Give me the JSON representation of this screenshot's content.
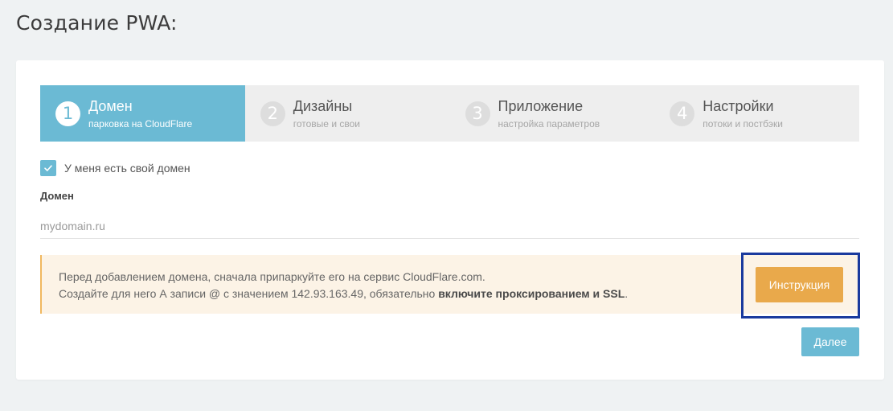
{
  "page": {
    "title": "Создание PWA:"
  },
  "steps": [
    {
      "num": "1",
      "title": "Домен",
      "sub": "парковка на CloudFlare",
      "active": true
    },
    {
      "num": "2",
      "title": "Дизайны",
      "sub": "готовые и свои",
      "active": false
    },
    {
      "num": "3",
      "title": "Приложение",
      "sub": "настройка параметров",
      "active": false
    },
    {
      "num": "4",
      "title": "Настройки",
      "sub": "потоки и постбэки",
      "active": false
    }
  ],
  "own_domain": {
    "label": "У меня есть свой домен",
    "checked": true
  },
  "domain_field": {
    "label": "Домен",
    "placeholder": "mydomain.ru",
    "value": ""
  },
  "notice": {
    "line1": "Перед добавлением домена, сначала припаркуйте его на сервис CloudFlare.com.",
    "line2_prefix": "Создайте для него А записи @ с значением 142.93.163.49, обязательно ",
    "line2_bold": "включите проксированием и SSL",
    "line2_suffix": "."
  },
  "buttons": {
    "instruction": "Инструкция",
    "next": "Далее"
  },
  "colors": {
    "primary": "#6bbad4",
    "warning": "#e9a94b",
    "notice_bg": "#fcf3e6",
    "highlight": "#1a3a9e"
  },
  "icons": {
    "checkbox": "checkmark-icon"
  }
}
